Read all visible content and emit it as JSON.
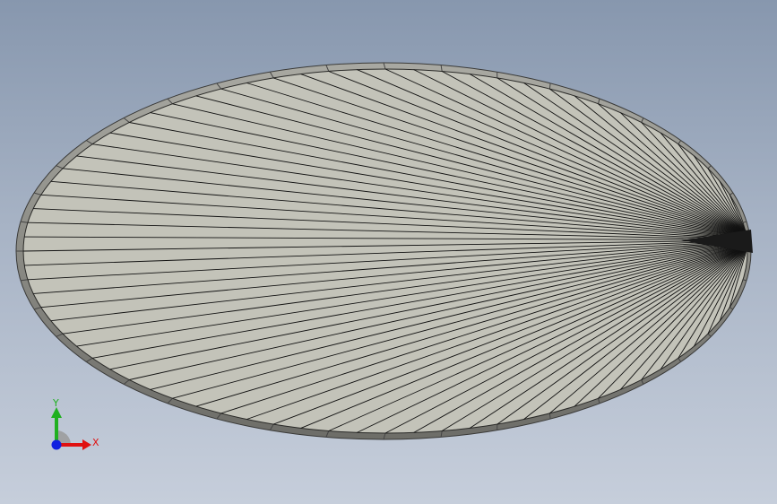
{
  "viewport": {
    "background_top": "#8797ae",
    "background_bottom": "#c6cedb"
  },
  "model": {
    "name_icon": "elliptical-plate-mesh",
    "face_color": "#c3c3b9",
    "rim_color": "#8e8e88",
    "rim_dark_color": "#5c5c58",
    "edge_color": "#000000"
  },
  "triad": {
    "x_label": "X",
    "y_label": "Y",
    "x_color": "#e01010",
    "y_color": "#20b020",
    "z_color": "#1020e0"
  }
}
